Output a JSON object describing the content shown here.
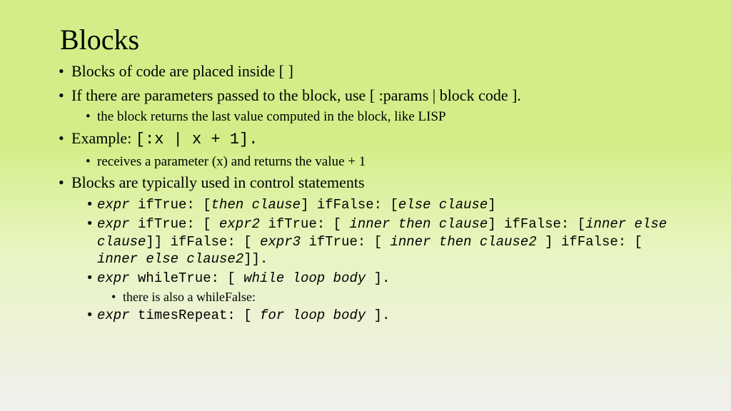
{
  "title": "Blocks",
  "b1": "Blocks of code are placed inside [ ]",
  "b2": "If there are parameters passed to the block, use [ :params |  block code ].",
  "b2a": "the block returns the last value computed in the block, like LISP",
  "b3_pre": "Example: ",
  "b3_code": "[:x | x + 1].",
  "b3a": "receives a parameter (x) and returns the value + 1",
  "b4": "Blocks are typically used in control statements",
  "b4a_e1": "expr",
  "b4a_t1": " ifTrue: [",
  "b4a_e2": "then clause",
  "b4a_t2": "] ifFalse: [",
  "b4a_e3": "else clause",
  "b4a_t3": "]",
  "b4b_e1": "expr",
  "b4b_t1": " ifTrue: [ ",
  "b4b_e2": "expr2",
  "b4b_t2": " ifTrue: [ ",
  "b4b_e3": "inner then clause",
  "b4b_t3": "] ifFalse: [",
  "b4b_e4": "inner else clause",
  "b4b_t4": "]] ifFalse: [ ",
  "b4b_e5": "expr3",
  "b4b_t5": " ifTrue: [ ",
  "b4b_e6": "inner then clause2",
  "b4b_t6": " ] ifFalse: [ ",
  "b4b_e7": "inner else clause2",
  "b4b_t7": "]].",
  "b4c_e1": "expr",
  "b4c_t1": " whileTrue: [ ",
  "b4c_e2": "while loop body",
  "b4c_t2": " ].",
  "b4c1": "there is also a whileFalse:",
  "b4d_e1": "expr",
  "b4d_t1": " timesRepeat: [ ",
  "b4d_e2": "for loop body",
  "b4d_t2": " ]."
}
